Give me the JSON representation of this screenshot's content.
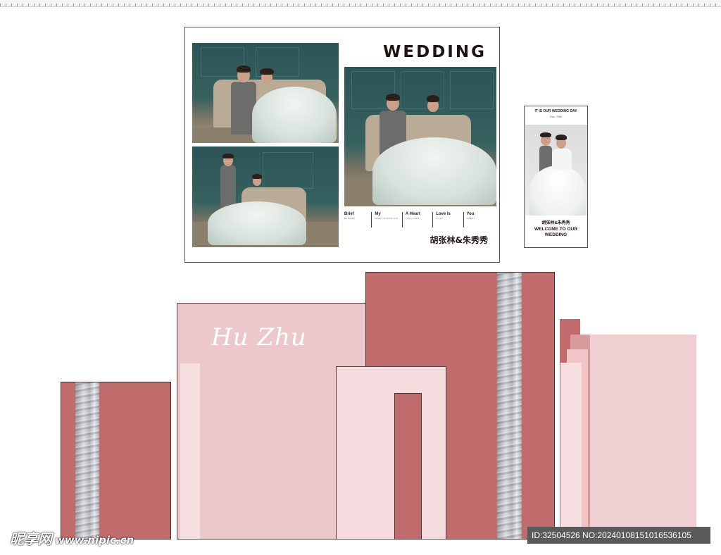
{
  "poster": {
    "title": "WEDDING",
    "names": "胡张林&朱秀秀",
    "keywords": [
      {
        "label": "Brief",
        "sub": "BE BRIEF"
      },
      {
        "label": "My",
        "sub": "HEART IS WITH YOU"
      },
      {
        "label": "A Heart",
        "sub": "TWO LOVES"
      },
      {
        "label": "Love Is",
        "sub": "A GIFT"
      },
      {
        "label": "You",
        "sub": "SWEET"
      }
    ]
  },
  "banner": {
    "top_text": "IT IS OUR WEDDING DAY",
    "date": "Dec. 28th",
    "names": "胡张林&朱秀秀",
    "welcome": "WELCOME TO OUR WEDDING"
  },
  "backdrop": {
    "script_text": "Hu Zhu"
  },
  "colors": {
    "mauve": "#c06b6c",
    "pink": "#ecc8ca",
    "light_pink": "#f5dcde",
    "silver": "#b8b9bf"
  },
  "watermark": {
    "brand": "昵享网",
    "url": "www.nipic.cn",
    "id_text": "ID:32504526 NO:20240108151016536105"
  }
}
